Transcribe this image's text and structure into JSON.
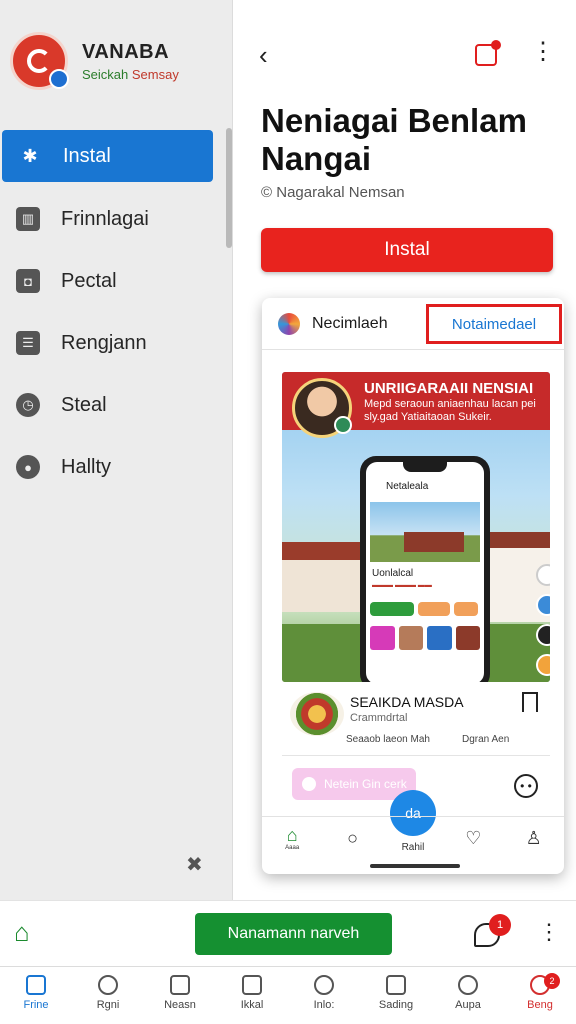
{
  "brand": {
    "name": "VANABA",
    "subtitle_a": "Seickah",
    "subtitle_b": "Semsay"
  },
  "drawer": {
    "items": [
      {
        "label": "Instal",
        "icon": "gear-icon",
        "active": true
      },
      {
        "label": "Frinnlagai",
        "icon": "grid-icon"
      },
      {
        "label": "Pectal",
        "icon": "camera-icon"
      },
      {
        "label": "Rengjann",
        "icon": "list-icon"
      },
      {
        "label": "Steal",
        "icon": "clock-icon"
      },
      {
        "label": "Hallty",
        "icon": "drop-icon"
      }
    ]
  },
  "detail": {
    "title": "Neniagai Benlam Nangai",
    "developer": "Nagarakal Nemsan",
    "install_label": "Instal"
  },
  "preview": {
    "app_name": "Necimlaeh",
    "tab_label": "Notaimedael",
    "banner_title": "UNRIIGARAAII NENSIAI",
    "banner_desc": "Mepd seraoun aniaenhau lacan pei sly.gad Yatiaitaoan Sukeir.",
    "phone_title": "Netaleala",
    "phone_card_title": "Uonlalcal",
    "item_title": "SEAIKDA MASDA",
    "item_sub": "Crammdrtal",
    "item_meta_1": "Seaaob laeon Mah",
    "item_meta_2": "Dgran Aen",
    "pill_label": "Netein Gin cerk",
    "fab_label": "da",
    "nav": [
      {
        "label": "Aaaa",
        "icon": "home-icon"
      },
      {
        "label": "",
        "icon": "search-icon"
      },
      {
        "label": "Rahil",
        "icon": "plus-icon"
      },
      {
        "label": "",
        "icon": "heart-icon"
      },
      {
        "label": "",
        "icon": "user-icon"
      }
    ]
  },
  "actionbar": {
    "cta_label": "Nanamann narveh",
    "chat_badge": "1"
  },
  "bottom_nav": [
    {
      "label": "Frine",
      "icon": "home-icon",
      "state": "active"
    },
    {
      "label": "Rgni",
      "icon": "search-icon"
    },
    {
      "label": "Neasn",
      "icon": "chat-icon"
    },
    {
      "label": "Ikkal",
      "icon": "book-icon"
    },
    {
      "label": "Inlo:",
      "icon": "heart-icon"
    },
    {
      "label": "Sading",
      "icon": "card-icon"
    },
    {
      "label": "Aupa",
      "icon": "user-icon"
    },
    {
      "label": "Beng",
      "icon": "bell-icon",
      "state": "alert",
      "badge": "2"
    }
  ],
  "colors": {
    "accent_blue": "#1976d2",
    "install_red": "#e8231e",
    "cta_green": "#159031"
  }
}
